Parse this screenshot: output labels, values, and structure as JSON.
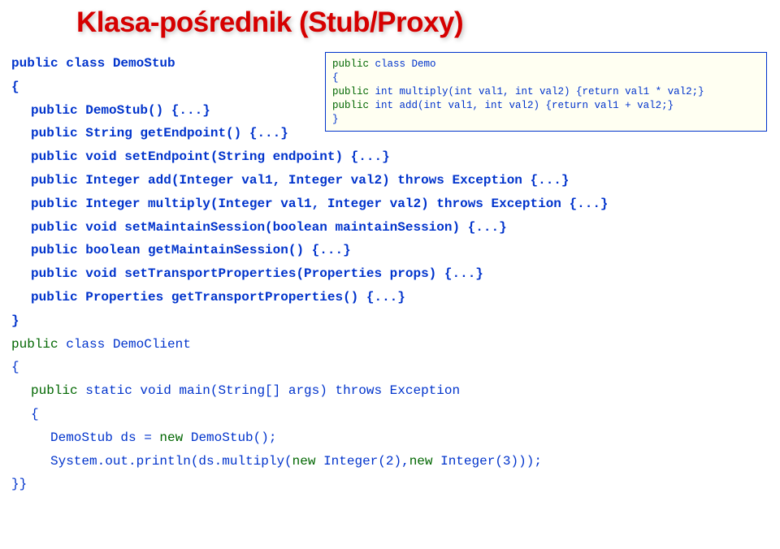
{
  "title": "Klasa-pośrednik (Stub/Proxy)",
  "box": {
    "l1a": "public",
    "l1b": " class Demo",
    "l2": "{",
    "l3a": "  public",
    "l3b": " int multiply(int val1, int val2) {return val1 * val2;}",
    "l4a": "  public",
    "l4b": " int add(int val1, int val2) {return val1 + val2;}",
    "l5": "}"
  },
  "stub": {
    "l1": "public class DemoStub",
    "l2": "{",
    "l3": "public DemoStub() {...}",
    "l4": "public String getEndpoint() {...}",
    "l5": "public void setEndpoint(String endpoint) {...}",
    "l6": "public Integer add(Integer val1, Integer val2) throws Exception {...}",
    "l7": "public Integer multiply(Integer val1, Integer val2) throws Exception {...}",
    "l8": "public void setMaintainSession(boolean maintainSession) {...}",
    "l9": "public boolean getMaintainSession() {...}",
    "l10": "public void setTransportProperties(Properties props) {...}",
    "l11": "public Properties getTransportProperties() {...}",
    "l12": "}"
  },
  "client": {
    "l1a": "public",
    "l1b": " class DemoClient",
    "l2": "{",
    "l3a": "public",
    "l3b": " static void main(String[] args) throws Exception",
    "l4": "{",
    "l5a": "DemoStub ds = ",
    "l5b": "new",
    "l5c": " DemoStub();",
    "l6a": "System.out.println(ds.multiply(",
    "l6b": "new",
    "l6c": " Integer(2),",
    "l6d": "new",
    "l6e": " Integer(3)));",
    "l7": "}}"
  }
}
